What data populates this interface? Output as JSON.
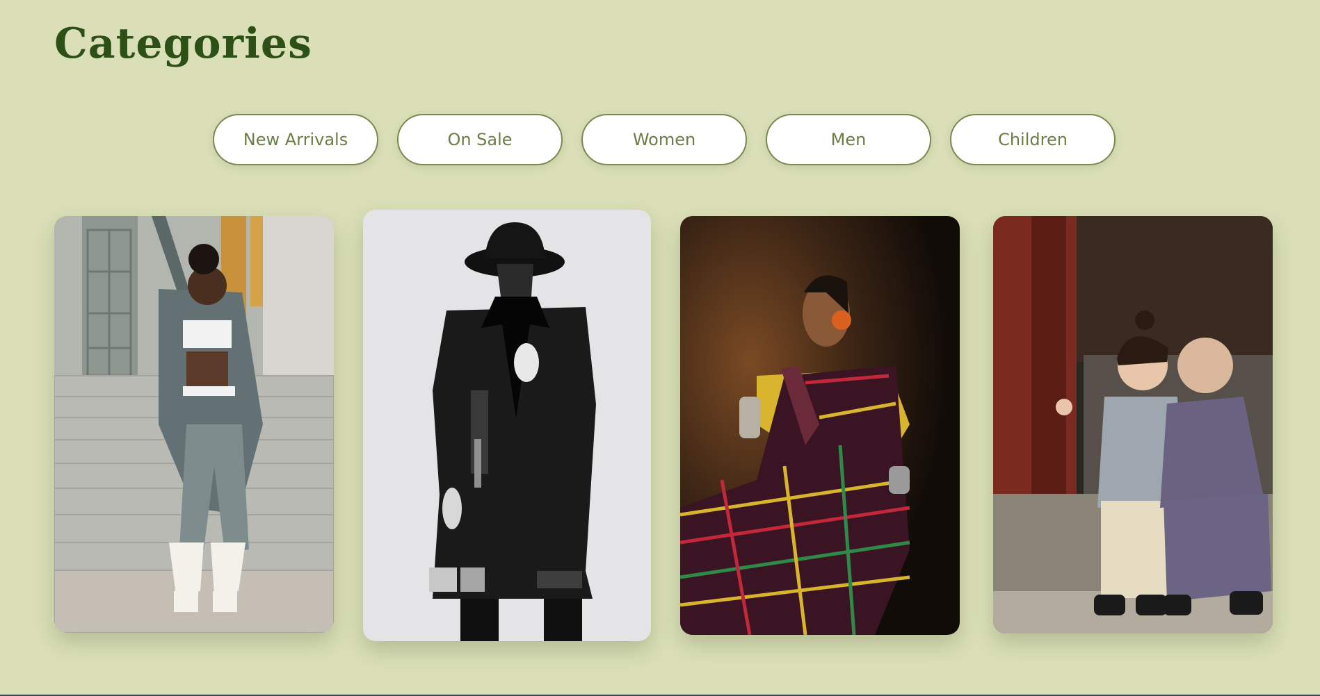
{
  "header": {
    "title": "Categories"
  },
  "categories": [
    {
      "label": "New Arrivals"
    },
    {
      "label": "On Sale"
    },
    {
      "label": "Women"
    },
    {
      "label": "Men"
    },
    {
      "label": "Children"
    }
  ],
  "cards": [
    {
      "subject": "woman-in-grey-suit-on-stairs"
    },
    {
      "subject": "man-in-black-hat-and-coat"
    },
    {
      "subject": "woman-in-plaid-saree"
    },
    {
      "subject": "two-children-on-step"
    }
  ],
  "colors": {
    "background": "#dadfb7",
    "title": "#2d5016",
    "pill_border": "#788a52",
    "pill_text": "#6a7d46"
  }
}
